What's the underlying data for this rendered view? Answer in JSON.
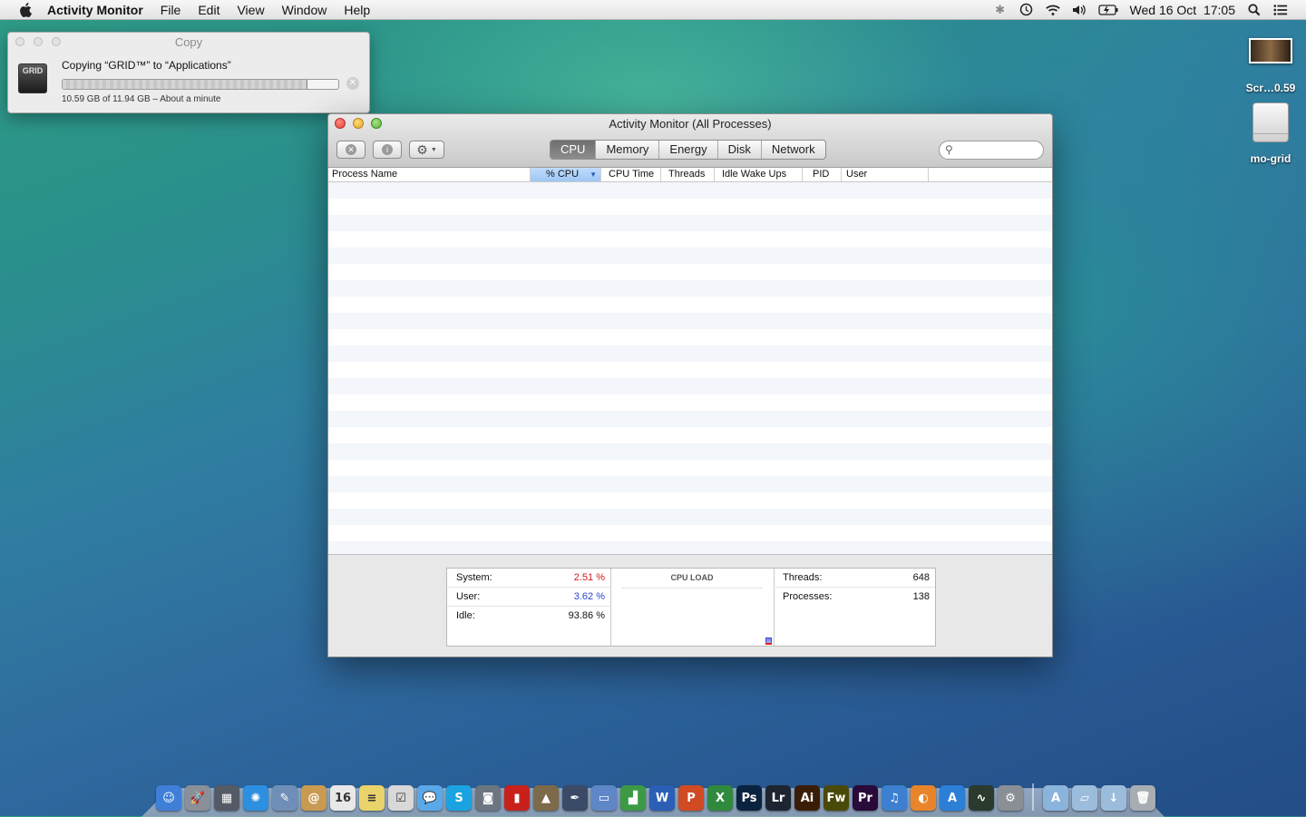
{
  "menubar": {
    "app_name": "Activity Monitor",
    "items": [
      "File",
      "Edit",
      "View",
      "Window",
      "Help"
    ],
    "clock": "Wed 16 Oct  17:05"
  },
  "copy_dialog": {
    "title": "Copy",
    "icon_text": "GRID",
    "message": "Copying “GRID™” to “Applications”",
    "progress_fraction": 0.887,
    "status": "10.59 GB of 11.94 GB – About a minute"
  },
  "activity_monitor": {
    "title": "Activity Monitor (All Processes)",
    "tabs": [
      "CPU",
      "Memory",
      "Energy",
      "Disk",
      "Network"
    ],
    "active_tab": "CPU",
    "search_placeholder": "",
    "columns": [
      "Process Name",
      "% CPU",
      "CPU Time",
      "Threads",
      "Idle Wake Ups",
      "PID",
      "User"
    ],
    "sorted_column": "% CPU",
    "stats": {
      "system_label": "System:",
      "system_value": "2.51 %",
      "system_color": "#d0191c",
      "user_label": "User:",
      "user_value": "3.62 %",
      "user_color": "#2a47c8",
      "idle_label": "Idle:",
      "idle_value": "93.86 %",
      "cpu_load_title": "CPU LOAD",
      "threads_label": "Threads:",
      "threads_value": "648",
      "processes_label": "Processes:",
      "processes_value": "138"
    }
  },
  "desktop": {
    "icons": [
      {
        "label": "Scr…0.59",
        "type": "screenshot-thumbnail"
      },
      {
        "label": "mo-grid",
        "type": "disk-image"
      }
    ]
  },
  "dock": {
    "apps": [
      {
        "name": "finder-icon",
        "glyph": "☺",
        "color": "#3f7fd8"
      },
      {
        "name": "launchpad-icon",
        "glyph": "🚀",
        "color": "#8a8f98"
      },
      {
        "name": "mission-control-icon",
        "glyph": "▦",
        "color": "#555b66"
      },
      {
        "name": "safari-icon",
        "glyph": "✺",
        "color": "#2d8fe0"
      },
      {
        "name": "preview-icon",
        "glyph": "✎",
        "color": "#6f8fb8"
      },
      {
        "name": "contacts-icon",
        "glyph": "@",
        "color": "#c89a52"
      },
      {
        "name": "calendar-icon",
        "glyph": "16",
        "color": "#e8e8e8"
      },
      {
        "name": "notes-icon",
        "glyph": "≡",
        "color": "#e9d36b"
      },
      {
        "name": "reminders-icon",
        "glyph": "☑",
        "color": "#d8d8d8"
      },
      {
        "name": "messages-icon",
        "glyph": "💬",
        "color": "#5aa8e8"
      },
      {
        "name": "skype-icon",
        "glyph": "S",
        "color": "#1aa3e0"
      },
      {
        "name": "facetime-icon",
        "glyph": "◙",
        "color": "#6c7580"
      },
      {
        "name": "photo-booth-icon",
        "glyph": "▮",
        "color": "#c8211c"
      },
      {
        "name": "iphoto-icon",
        "glyph": "▲",
        "color": "#7c6a4a"
      },
      {
        "name": "pixelmator-icon",
        "glyph": "✒",
        "color": "#3b4a66"
      },
      {
        "name": "keynote-icon",
        "glyph": "▭",
        "color": "#5f86c7"
      },
      {
        "name": "numbers-icon",
        "glyph": "▟",
        "color": "#3c9a45"
      },
      {
        "name": "word-icon",
        "glyph": "W",
        "color": "#2a5fb5"
      },
      {
        "name": "powerpoint-icon",
        "glyph": "P",
        "color": "#d04a22"
      },
      {
        "name": "excel-icon",
        "glyph": "X",
        "color": "#2f8a3d"
      },
      {
        "name": "photoshop-icon",
        "glyph": "Ps",
        "color": "#0a2340"
      },
      {
        "name": "lightroom-icon",
        "glyph": "Lr",
        "color": "#1e2530"
      },
      {
        "name": "illustrator-icon",
        "glyph": "Ai",
        "color": "#3a1d06"
      },
      {
        "name": "fireworks-icon",
        "glyph": "Fw",
        "color": "#4a4a08"
      },
      {
        "name": "premiere-icon",
        "glyph": "Pr",
        "color": "#2a0a3a"
      },
      {
        "name": "itunes-icon",
        "glyph": "♫",
        "color": "#3d7fd0"
      },
      {
        "name": "ibooks-icon",
        "glyph": "◐",
        "color": "#e8852a"
      },
      {
        "name": "app-store-icon",
        "glyph": "A",
        "color": "#2b7fd6"
      },
      {
        "name": "activity-monitor-icon",
        "glyph": "∿",
        "color": "#2a3a2c"
      },
      {
        "name": "system-preferences-icon",
        "glyph": "⚙",
        "color": "#8a8f96"
      }
    ],
    "stacks": [
      {
        "name": "applications-folder-icon",
        "glyph": "A",
        "color": "#8ab4dc"
      },
      {
        "name": "documents-folder-icon",
        "glyph": "▱",
        "color": "#9cbcdc"
      },
      {
        "name": "downloads-folder-icon",
        "glyph": "↓",
        "color": "#9cbcdc"
      },
      {
        "name": "trash-icon",
        "glyph": "🗑",
        "color": "#a8adb3"
      }
    ]
  }
}
